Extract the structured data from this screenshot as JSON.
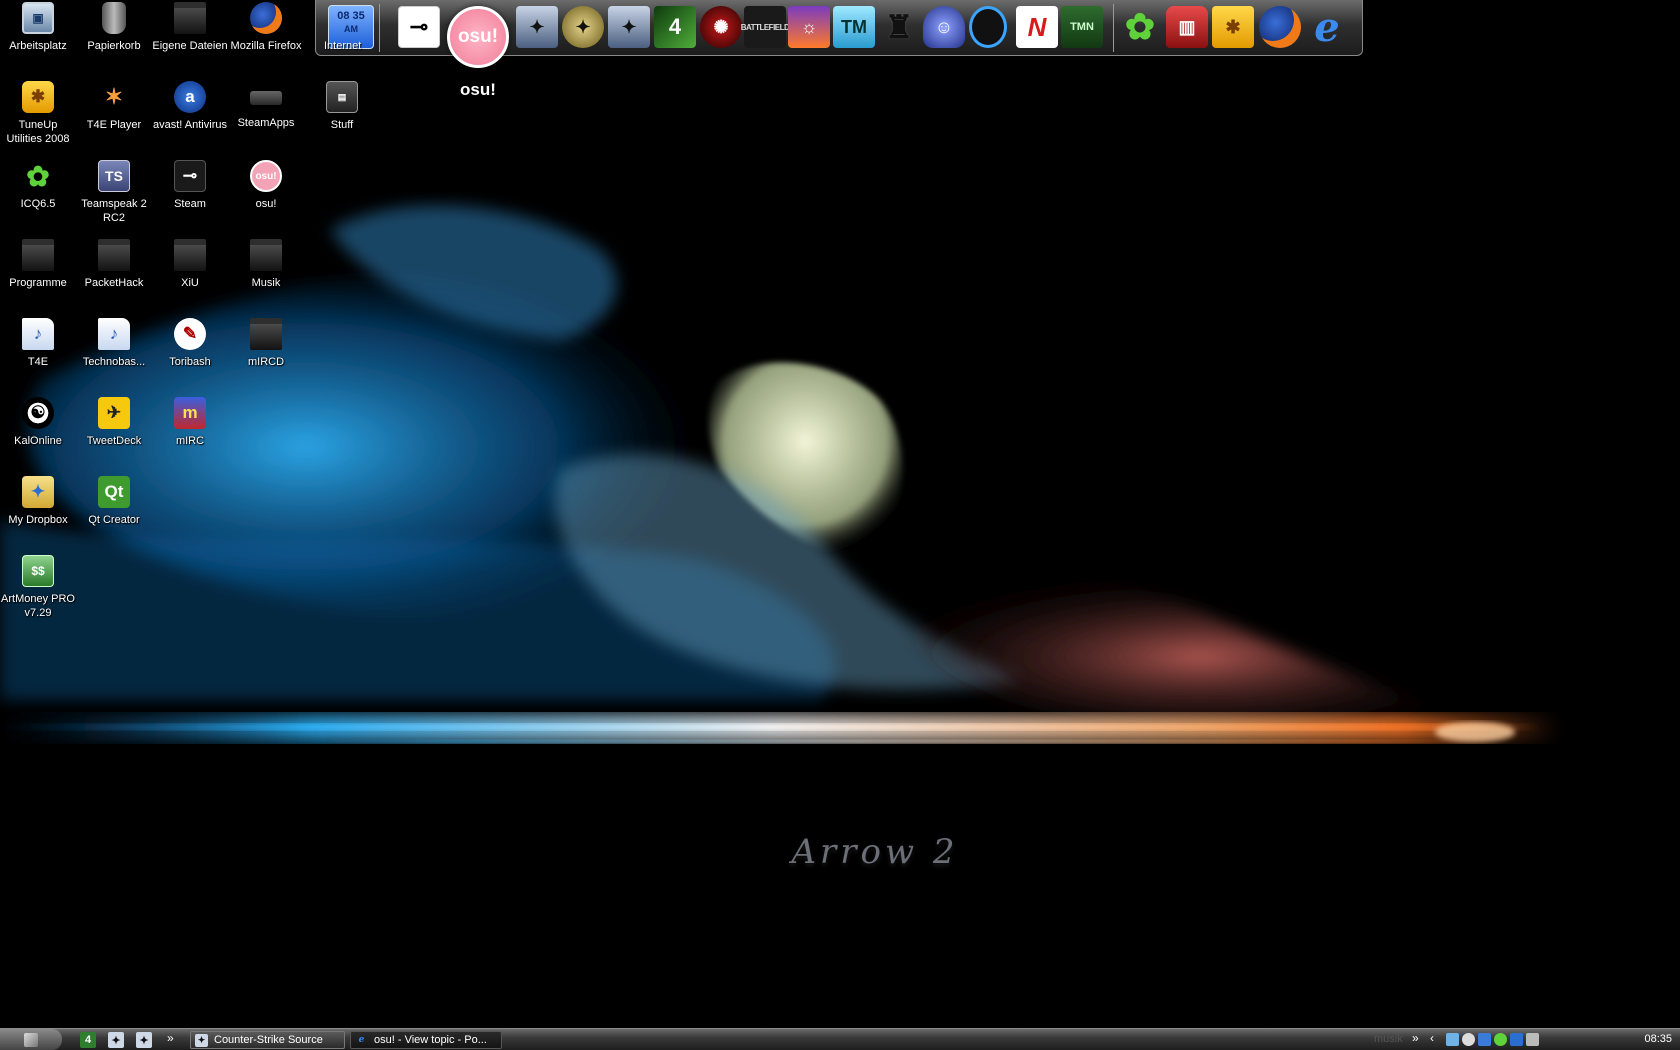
{
  "desktop": {
    "icons": [
      {
        "label": "Arbeitsplatz",
        "icon": "computer-icon",
        "glyph": "▣"
      },
      {
        "label": "Papierkorb",
        "icon": "recycle-bin-icon",
        "glyph": ""
      },
      {
        "label": "Eigene Dateien",
        "icon": "folder-icon",
        "glyph": ""
      },
      {
        "label": "Mozilla Firefox",
        "icon": "firefox-icon",
        "glyph": ""
      },
      {
        "label": "TuneUp Utilities 2008",
        "icon": "tuneup-icon",
        "glyph": "✱"
      },
      {
        "label": "T4E Player",
        "icon": "t4e-player-icon",
        "glyph": "✶"
      },
      {
        "label": "avast! Antivirus",
        "icon": "avast-icon",
        "glyph": "a"
      },
      {
        "label": "SteamApps",
        "icon": "drive-icon",
        "glyph": ""
      },
      {
        "label": "Stuff",
        "icon": "stuff-icon",
        "glyph": "▤"
      },
      {
        "label": "ICQ6.5",
        "icon": "icq-flower-icon",
        "glyph": "✿"
      },
      {
        "label": "Teamspeak 2 RC2",
        "icon": "teamspeak-icon",
        "glyph": "TS"
      },
      {
        "label": "Steam",
        "icon": "steam-icon",
        "glyph": "⊸"
      },
      {
        "label": "osu!",
        "icon": "osu-icon",
        "glyph": "osu!"
      },
      {
        "label": "Programme",
        "icon": "folder-icon",
        "glyph": ""
      },
      {
        "label": "PacketHack",
        "icon": "folder-icon",
        "glyph": ""
      },
      {
        "label": "XiU",
        "icon": "folder-icon",
        "glyph": ""
      },
      {
        "label": "Musik",
        "icon": "folder-icon",
        "glyph": ""
      },
      {
        "label": "T4E",
        "icon": "document-icon",
        "glyph": "♪"
      },
      {
        "label": "Technobas...",
        "icon": "document-icon",
        "glyph": "♪"
      },
      {
        "label": "Toribash",
        "icon": "toribash-icon",
        "glyph": "✎"
      },
      {
        "label": "mIRCD",
        "icon": "folder-icon",
        "glyph": ""
      },
      {
        "label": "KalOnline",
        "icon": "kalonline-icon",
        "glyph": "☯"
      },
      {
        "label": "TweetDeck",
        "icon": "tweetdeck-icon",
        "glyph": "✈"
      },
      {
        "label": "mIRC",
        "icon": "mirc-icon",
        "glyph": "m"
      },
      {
        "label": "My Dropbox",
        "icon": "dropbox-icon",
        "glyph": "✦"
      },
      {
        "label": "Qt Creator",
        "icon": "qt-icon",
        "glyph": "Qt"
      },
      {
        "label": "ArtMoney PRO v7.29",
        "icon": "artmoney-icon",
        "glyph": "$$"
      }
    ]
  },
  "wallpaper": {
    "caption": "Arrow 2"
  },
  "dock": {
    "clock_lines": [
      "08 35",
      "AM"
    ],
    "internet_label": "Internet",
    "hover_label": "osu!",
    "hover_glyph": "osu!",
    "items": [
      {
        "icon": "steam-dock-icon",
        "glyph": "⊸"
      },
      {
        "icon": "counter-strike-icon",
        "glyph": "✦"
      },
      {
        "icon": "counter-strike-condition-zero-icon",
        "glyph": "✦"
      },
      {
        "icon": "counter-strike-source-icon",
        "glyph": "✦"
      },
      {
        "icon": "left4dead-icon",
        "glyph": "4"
      },
      {
        "icon": "red-game-icon",
        "glyph": "✺"
      },
      {
        "icon": "battlefield-icon",
        "glyph": "BATTLEFIELD"
      },
      {
        "icon": "racing-game-icon",
        "glyph": "☼"
      },
      {
        "icon": "trackmania-icon",
        "glyph": "TM"
      },
      {
        "icon": "top-hat-icon",
        "glyph": "♜"
      },
      {
        "icon": "wizard-game-icon",
        "glyph": "☺"
      },
      {
        "icon": "portal-icon",
        "glyph": ""
      },
      {
        "icon": "need-for-speed-icon",
        "glyph": "N"
      },
      {
        "icon": "trackmania-nations-icon",
        "glyph": "TMN"
      },
      {
        "icon": "icq-dock-icon",
        "glyph": "✿"
      },
      {
        "icon": "lock-icon",
        "glyph": "▥"
      },
      {
        "icon": "tuneup-dock-icon",
        "glyph": "✱"
      },
      {
        "icon": "firefox-dock-icon",
        "glyph": ""
      },
      {
        "icon": "internet-explorer-icon",
        "glyph": "e"
      }
    ]
  },
  "taskbar": {
    "quicklaunch": [
      {
        "icon": "left4dead-quicklaunch-icon",
        "glyph": "4"
      },
      {
        "icon": "counter-strike-quicklaunch-icon",
        "glyph": "✦"
      },
      {
        "icon": "counter-strike-source-quicklaunch-icon",
        "glyph": "✦"
      }
    ],
    "more_glyph": "»",
    "tasks": [
      {
        "label": "Counter-Strike Source",
        "icon": "counter-strike-task-icon",
        "glyph": "✦"
      },
      {
        "label": "osu! - View topic - Po...",
        "icon": "internet-explorer-task-icon",
        "glyph": "e"
      }
    ],
    "tray": {
      "toolbar_label": "musik",
      "expand_glyph": "»",
      "collapse_glyph": "‹",
      "clock": "08:35"
    }
  },
  "colors": {
    "desktop_background": "#000000",
    "osu_pink": "#f07d98",
    "glow_cyan": "#2fb7ff",
    "glow_orange": "#ff7a2a"
  }
}
